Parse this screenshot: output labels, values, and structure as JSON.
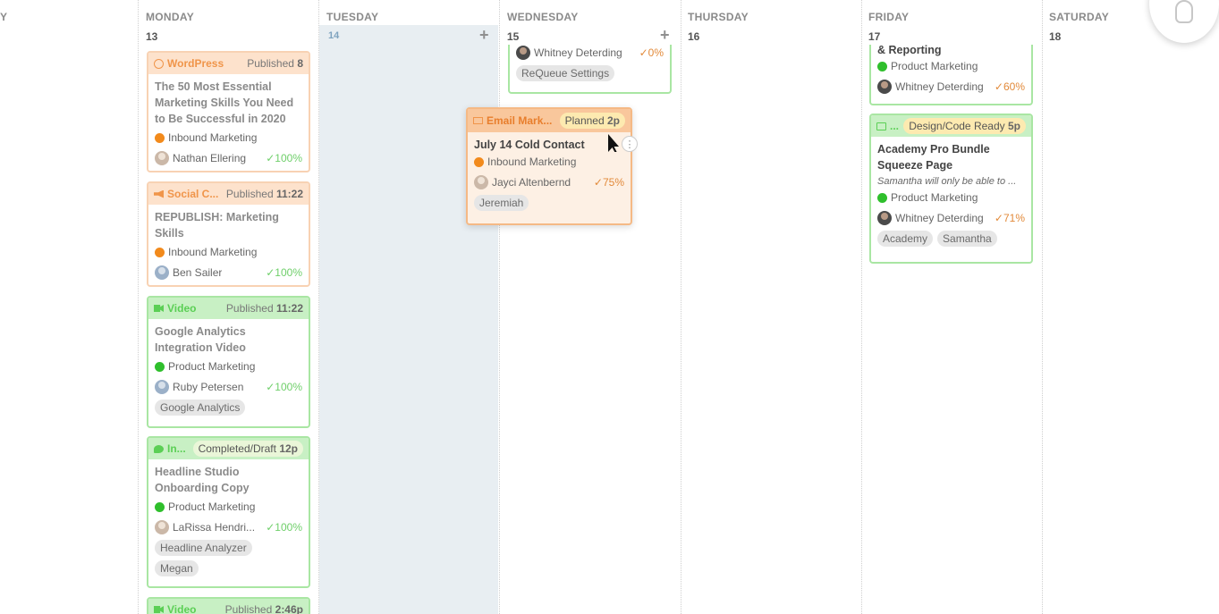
{
  "days": [
    {
      "name": "Y",
      "num": ""
    },
    {
      "name": "MONDAY",
      "num": "13"
    },
    {
      "name": "TUESDAY",
      "num": "14"
    },
    {
      "name": "WEDNESDAY",
      "num": "15"
    },
    {
      "name": "THURSDAY",
      "num": "16"
    },
    {
      "name": "FRIDAY",
      "num": "17"
    },
    {
      "name": "SATURDAY",
      "num": "18"
    }
  ],
  "add_label": "+",
  "monday_cards": [
    {
      "type": "WordPress",
      "status": "Published",
      "time": "8",
      "title": "The 50 Most Essential Marketing Skills You Need to Be Successful in 2020",
      "team": "Inbound Marketing",
      "person": "Nathan Ellering",
      "pct": "100%"
    },
    {
      "type": "Social C...",
      "status": "Published",
      "time": "11:22",
      "title": "REPUBLISH: Marketing Skills",
      "team": "Inbound Marketing",
      "person": "Ben Sailer",
      "pct": "100%"
    },
    {
      "type": "Video",
      "status": "Published",
      "time": "11:22",
      "title": "Google Analytics Integration Video",
      "team": "Product Marketing",
      "person": "Ruby Petersen",
      "pct": "100%",
      "tags": [
        "Google Analytics"
      ]
    },
    {
      "type": "In...",
      "status": "Completed/Draft",
      "time": "12p",
      "title": "Headline Studio Onboarding Copy",
      "team": "Product Marketing",
      "person": "LaRissa Hendri...",
      "pct": "100%",
      "tags": [
        "Headline Analyzer",
        "Megan"
      ]
    },
    {
      "type": "Video",
      "status": "Published",
      "time": "2:46p"
    }
  ],
  "wednesday_card": {
    "person": "Whitney Deterding",
    "pct": "0%",
    "tag": "ReQueue Settings"
  },
  "dragged_card": {
    "type": "Email Mark...",
    "status": "Planned",
    "time": "2p",
    "title": "July 14 Cold Contact",
    "team": "Inbound Marketing",
    "person": "Jayci Altenbernd",
    "pct": "75%",
    "tag": "Jeremiah",
    "more": "⋮"
  },
  "friday_cards": [
    {
      "title_tail": "& Reporting",
      "team": "Product Marketing",
      "person": "Whitney Deterding",
      "pct": "60%"
    },
    {
      "type": "...",
      "status": "Design/Code Ready",
      "time": "5p",
      "title": "Academy Pro Bundle Squeeze Page",
      "note": "Samantha will only be able to ...",
      "team": "Product Marketing",
      "person": "Whitney Deterding",
      "pct": "71%",
      "tags": [
        "Academy",
        "Samantha"
      ]
    }
  ],
  "check": "✓",
  "colors": {
    "orange_border": "#f8d2b3",
    "green_border": "#a9e6a3",
    "today_bg": "#e8eef2"
  }
}
